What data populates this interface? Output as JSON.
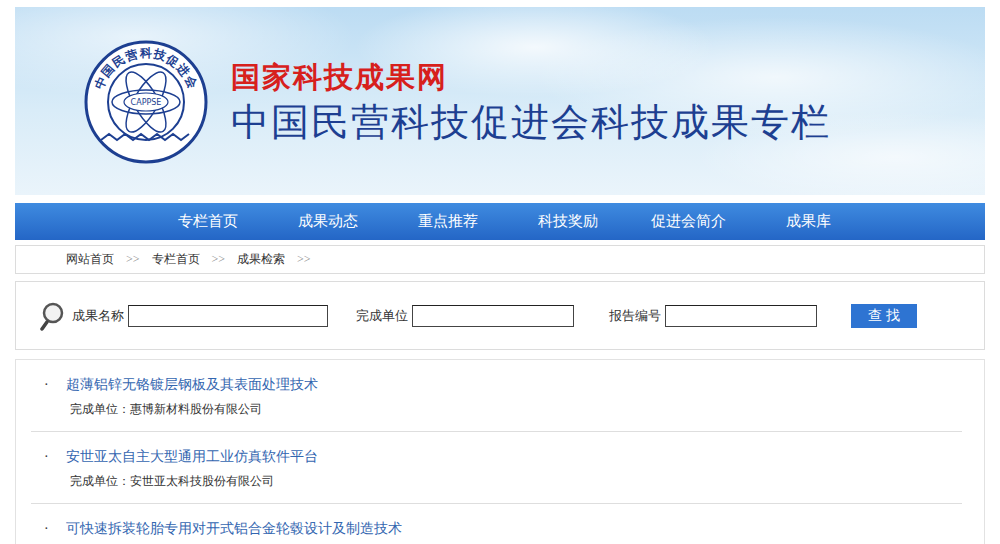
{
  "header": {
    "logo": {
      "ring_text": "中国民营科技促进会",
      "abbr": "CAPPSE"
    },
    "site_title": "国家科技成果网",
    "column_title": "中国民营科技促进会科技成果专栏"
  },
  "nav": [
    {
      "label": "专栏首页"
    },
    {
      "label": "成果动态"
    },
    {
      "label": "重点推荐"
    },
    {
      "label": "科技奖励"
    },
    {
      "label": "促进会简介"
    },
    {
      "label": "成果库"
    }
  ],
  "breadcrumb": {
    "items": [
      "网站首页",
      "专栏首页",
      "成果检索"
    ],
    "separator": ">>"
  },
  "search": {
    "fields": [
      {
        "label": "成果名称",
        "value": ""
      },
      {
        "label": "完成单位",
        "value": ""
      },
      {
        "label": "报告编号",
        "value": ""
      }
    ],
    "button": "查 找"
  },
  "results": [
    {
      "bullet": "·",
      "title": "超薄铝锌无铬镀层钢板及其表面处理技术",
      "unit_label": "完成单位：",
      "unit": "惠博新材料股份有限公司"
    },
    {
      "bullet": "·",
      "title": "安世亚太自主大型通用工业仿真软件平台",
      "unit_label": "完成单位：",
      "unit": "安世亚太科技股份有限公司"
    },
    {
      "bullet": "·",
      "title": "可快速拆装轮胎专用对开式铝合金轮毂设计及制造技术",
      "unit_label": "",
      "unit": ""
    }
  ]
}
